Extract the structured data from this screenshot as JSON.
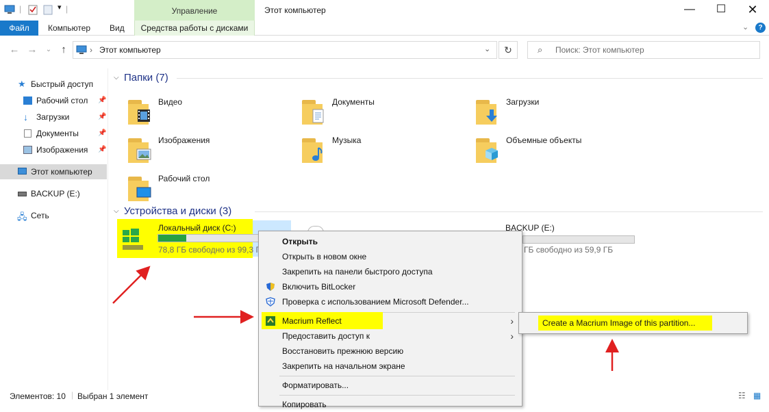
{
  "window": {
    "title": "Этот компьютер",
    "manage_tab": "Управление",
    "disk_tools_tab": "Средства работы с дисками"
  },
  "ribbon": {
    "file": "Файл",
    "computer": "Компьютер",
    "view": "Вид"
  },
  "address": {
    "path": "Этот компьютер",
    "search_placeholder": "Поиск: Этот компьютер"
  },
  "sidebar": {
    "quick_access": "Быстрый доступ",
    "items": [
      {
        "label": "Рабочий стол",
        "icon": "desktop-icon"
      },
      {
        "label": "Загрузки",
        "icon": "download-icon"
      },
      {
        "label": "Документы",
        "icon": "document-icon"
      },
      {
        "label": "Изображения",
        "icon": "pictures-icon"
      }
    ],
    "this_pc": "Этот компьютер",
    "backup": "BACKUP (E:)",
    "network": "Сеть"
  },
  "folders_group": {
    "title": "Папки (7)",
    "items": [
      {
        "label": "Видео",
        "icon": "video-folder-icon"
      },
      {
        "label": "Документы",
        "icon": "documents-folder-icon"
      },
      {
        "label": "Загрузки",
        "icon": "downloads-folder-icon"
      },
      {
        "label": "Изображения",
        "icon": "pictures-folder-icon"
      },
      {
        "label": "Музыка",
        "icon": "music-folder-icon"
      },
      {
        "label": "Объемные объекты",
        "icon": "3d-objects-folder-icon"
      },
      {
        "label": "Рабочий стол",
        "icon": "desktop-folder-icon"
      }
    ]
  },
  "drives_group": {
    "title": "Устройства и диски (3)",
    "drives": [
      {
        "label": "Локальный диск (C:)",
        "free": "78,8 ГБ свободно из 99,3 ГБ",
        "used_fraction": 0.21
      },
      {
        "label": "BACKUP (E:)",
        "free": "ГБ свободно из 59,9 ГБ",
        "used_fraction": 0.0
      }
    ]
  },
  "context_menu": {
    "items": [
      "Открыть",
      "Открыть в новом окне",
      "Закрепить на панели быстрого доступа",
      "Включить BitLocker",
      "Проверка с использованием Microsoft Defender...",
      "Macrium Reflect",
      "Предоставить доступ к",
      "Восстановить прежнюю версию",
      "Закрепить на начальном экране",
      "Форматировать...",
      "Копировать"
    ],
    "submenu_item": "Create a Macrium Image of this partition..."
  },
  "status": {
    "count": "Элементов: 10",
    "selected": "Выбран 1 элемент"
  },
  "colors": {
    "accent": "#1979ca",
    "highlight": "#ffff00",
    "arrow": "#e02020",
    "drive_bar": "#26a042"
  }
}
